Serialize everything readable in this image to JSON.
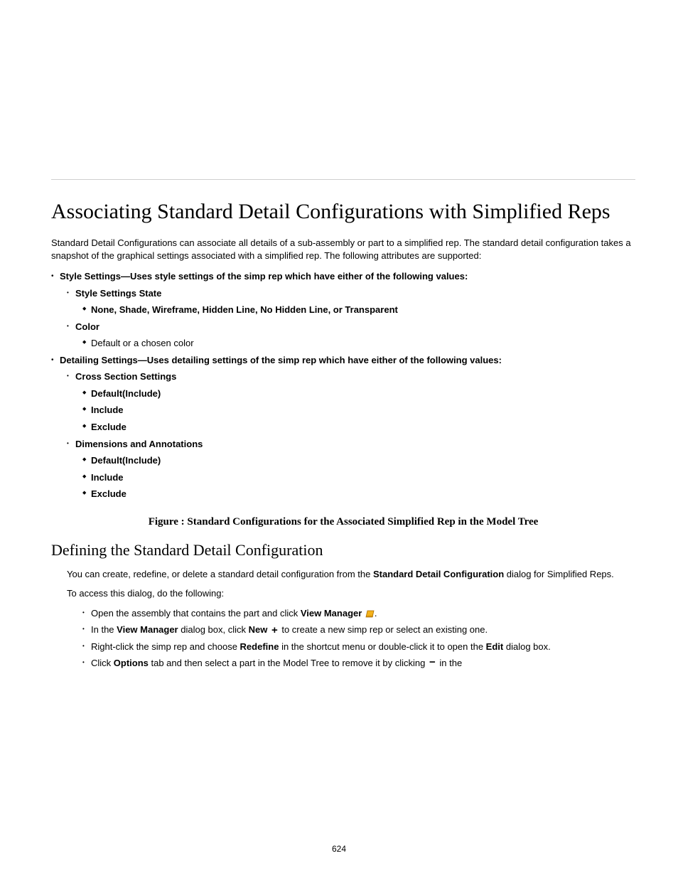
{
  "heading": "Associating Standard Detail Configurations with Simplified Reps",
  "section1": {
    "p1": "Standard Detail Configurations can associate all details of a sub-assembly or part to a simplified rep. The standard detail configuration takes a snapshot of the graphical settings associated with a simplified rep. The following attributes are supported:",
    "list": [
      {
        "text": "Style Settings—Uses style settings of the simp rep which have either of the following values:",
        "lvl": 1
      },
      {
        "text": "Style Settings State",
        "lvl": 2,
        "bold": true
      },
      {
        "text": "None, Shade, Wireframe, Hidden Line, No Hidden Line, or Transparent",
        "lvl": 3,
        "bold": true
      },
      {
        "text": "Color",
        "lvl": 2,
        "bold": true
      },
      {
        "text": "Default or a chosen color",
        "lvl": 3
      },
      {
        "text": "Detailing Settings—Uses detailing settings of the simp rep which have either of the following values:",
        "lvl": 1
      },
      {
        "text": "Cross Section Settings",
        "lvl": 2,
        "bold": true
      },
      {
        "text": "Default(Include)",
        "lvl": 3,
        "bold": true
      },
      {
        "text": "Include",
        "lvl": 3,
        "bold": true
      },
      {
        "text": "Exclude",
        "lvl": 3,
        "bold": true
      },
      {
        "text": "Dimensions and Annotations",
        "lvl": 2,
        "bold": true
      },
      {
        "text": "Default(Include)",
        "lvl": 3,
        "bold": true
      },
      {
        "text": "Include",
        "lvl": 3,
        "bold": true
      },
      {
        "text": "Exclude",
        "lvl": 3,
        "bold": true
      }
    ]
  },
  "caption1": "Figure : Standard Configurations for the Associated Simplified Rep in the Model Tree",
  "section2": {
    "title": "Defining the Standard Detail Configuration",
    "p1_a": "You can create, redefine, or delete a standard detail configuration from the ",
    "p1_b": "Standard Detail Configuration",
    "p1_c": " dialog for Simplified Reps.",
    "p2": "To access this dialog, do the following:",
    "list": [
      {
        "pre": "Open the assembly that contains the part and click ",
        "bold": "View Manager ",
        "post": ".",
        "icon": "note"
      },
      {
        "pre": "In the ",
        "bold": "View Manager",
        "post1": " dialog box, click ",
        "bold2": "New ",
        "icon": "plus",
        "post2": " to create a new simp rep or select an existing one."
      },
      {
        "pre": "Right-click the simp rep and choose ",
        "bold": "Redefine",
        "post1": " in the shortcut menu or double-click it to open the ",
        "bold2": "Edit",
        "post2": " dialog box."
      },
      {
        "pre": "Click ",
        "bold": "Options",
        "post1": " tab and then select a part in the Model Tree to remove it by clicking ",
        "icon": "minus",
        "post2": " in the"
      }
    ]
  },
  "page_number": "624"
}
